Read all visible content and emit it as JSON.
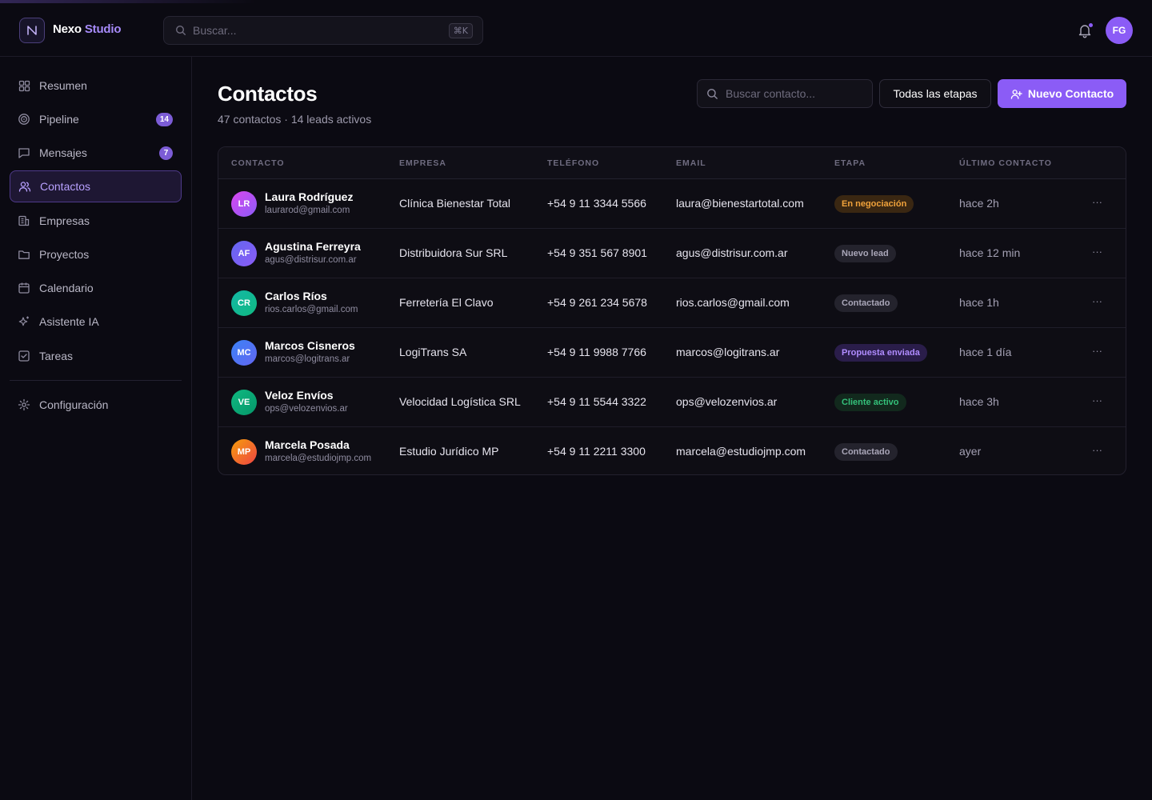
{
  "app": {
    "brand_part1": "Nexo",
    "brand_part2": "Studio",
    "search_placeholder": "Buscar...",
    "search_shortcut": "⌘K",
    "user_initials": "FG"
  },
  "sidebar": {
    "items": [
      {
        "label": "Resumen",
        "icon": "dashboard-icon"
      },
      {
        "label": "Pipeline",
        "icon": "target-icon",
        "badge": "14"
      },
      {
        "label": "Mensajes",
        "icon": "message-icon",
        "badge": "7"
      },
      {
        "label": "Contactos",
        "icon": "users-icon",
        "active": true
      },
      {
        "label": "Empresas",
        "icon": "building-icon"
      },
      {
        "label": "Proyectos",
        "icon": "folder-icon"
      },
      {
        "label": "Calendario",
        "icon": "calendar-icon"
      },
      {
        "label": "Asistente IA",
        "icon": "sparkle-icon"
      },
      {
        "label": "Tareas",
        "icon": "checkbox-icon"
      }
    ],
    "settings_label": "Configuración"
  },
  "main": {
    "title": "Contactos",
    "subtitle": "47 contactos · 14 leads activos",
    "search_placeholder": "Buscar contacto...",
    "stage_filter": "Todas las etapas",
    "new_button": "Nuevo Contacto"
  },
  "table": {
    "headers": [
      "CONTACTO",
      "EMPRESA",
      "TELÉFONO",
      "EMAIL",
      "ETAPA",
      "ÚLTIMO CONTACTO"
    ],
    "rows": [
      {
        "initials": "LR",
        "name": "Laura Rodríguez",
        "sub_email": "laurarod@gmail.com",
        "company": "Clínica Bienestar Total",
        "phone": "+54 9 11 3344 5566",
        "email": "laura@bienestartotal.com",
        "stage": "En negociación",
        "last": "hace 2h"
      },
      {
        "initials": "AF",
        "name": "Agustina Ferreyra",
        "sub_email": "agus@distrisur.com.ar",
        "company": "Distribuidora Sur SRL",
        "phone": "+54 9 351 567 8901",
        "email": "agus@distrisur.com.ar",
        "stage": "Nuevo lead",
        "last": "hace 12 min"
      },
      {
        "initials": "CR",
        "name": "Carlos Ríos",
        "sub_email": "rios.carlos@gmail.com",
        "company": "Ferretería El Clavo",
        "phone": "+54 9 261 234 5678",
        "email": "rios.carlos@gmail.com",
        "stage": "Contactado",
        "last": "hace 1h"
      },
      {
        "initials": "MC",
        "name": "Marcos Cisneros",
        "sub_email": "marcos@logitrans.ar",
        "company": "LogiTrans SA",
        "phone": "+54 9 11 9988 7766",
        "email": "marcos@logitrans.ar",
        "stage": "Propuesta enviada",
        "last": "hace 1 día"
      },
      {
        "initials": "VE",
        "name": "Veloz Envíos",
        "sub_email": "ops@velozenvios.ar",
        "company": "Velocidad Logística SRL",
        "phone": "+54 9 11 5544 3322",
        "email": "ops@velozenvios.ar",
        "stage": "Cliente activo",
        "last": "hace 3h"
      },
      {
        "initials": "MP",
        "name": "Marcela Posada",
        "sub_email": "marcela@estudiojmp.com",
        "company": "Estudio Jurídico MP",
        "phone": "+54 9 11 2211 3300",
        "email": "marcela@estudiojmp.com",
        "stage": "Contactado",
        "last": "ayer"
      }
    ],
    "more_label": "···"
  },
  "colors": {
    "accent": "#8b5cf6",
    "background": "#0b0a12",
    "stage_negotiation": "#f0a23b",
    "stage_active": "#34c17a",
    "stage_proposal": "#b08cff"
  }
}
